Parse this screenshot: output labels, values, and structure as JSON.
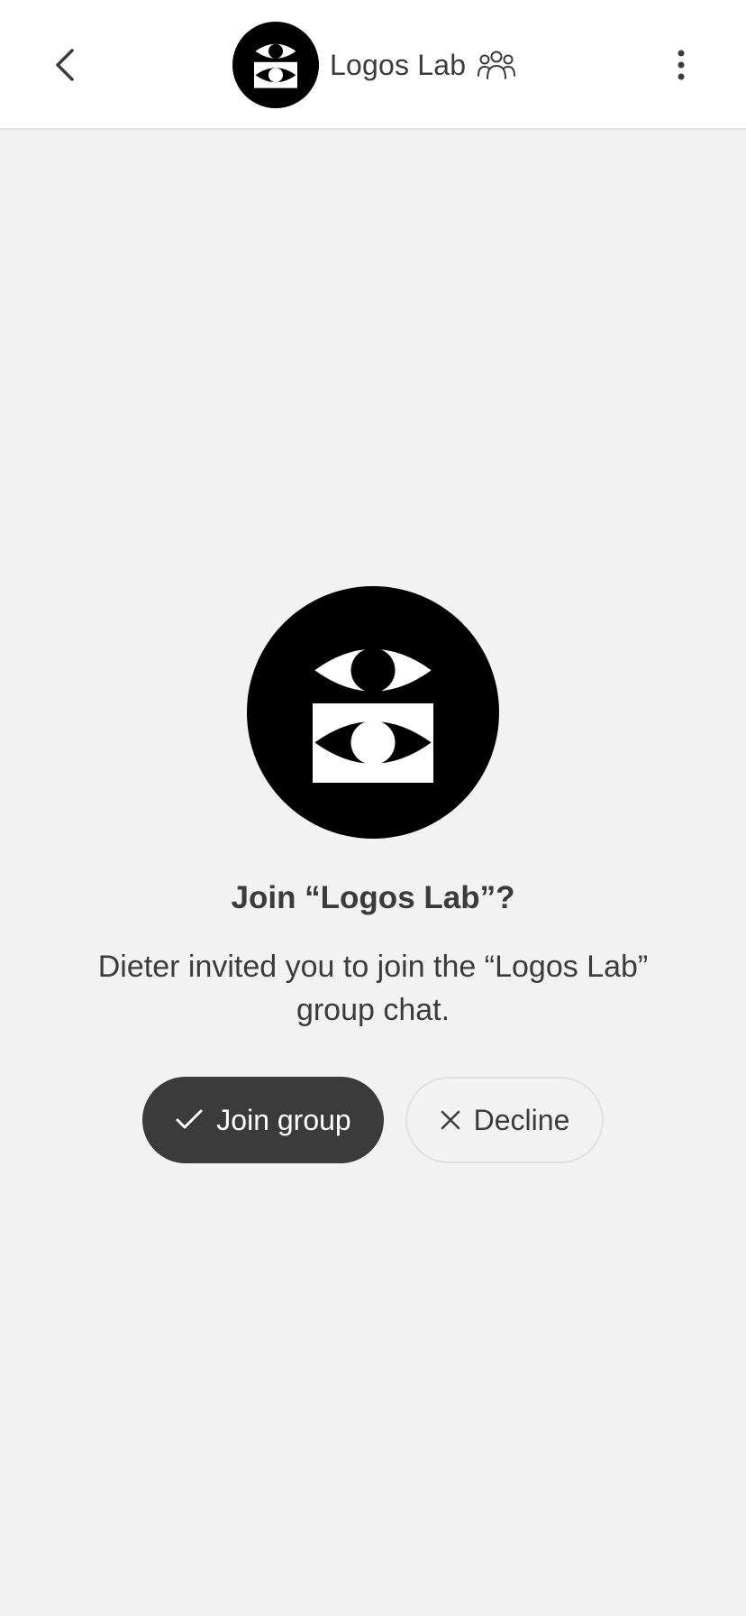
{
  "header": {
    "back_icon": "chevron-left-icon",
    "group_name": "Logos Lab",
    "group_icon": "group-people-icon",
    "more_icon": "more-vertical-icon",
    "avatar_icon": "eyes-logo-icon"
  },
  "invite": {
    "avatar_icon": "eyes-logo-icon",
    "title": "Join “Logos Lab”?",
    "description": "Dieter invited you to join the “Logos Lab” group chat.",
    "join_label": "Join group",
    "join_icon": "check-icon",
    "decline_label": "Decline",
    "decline_icon": "close-icon"
  },
  "colors": {
    "background": "#f2f2f2",
    "header_background": "#ffffff",
    "primary_button": "#3b3b3b",
    "text": "#3b3b3b"
  }
}
